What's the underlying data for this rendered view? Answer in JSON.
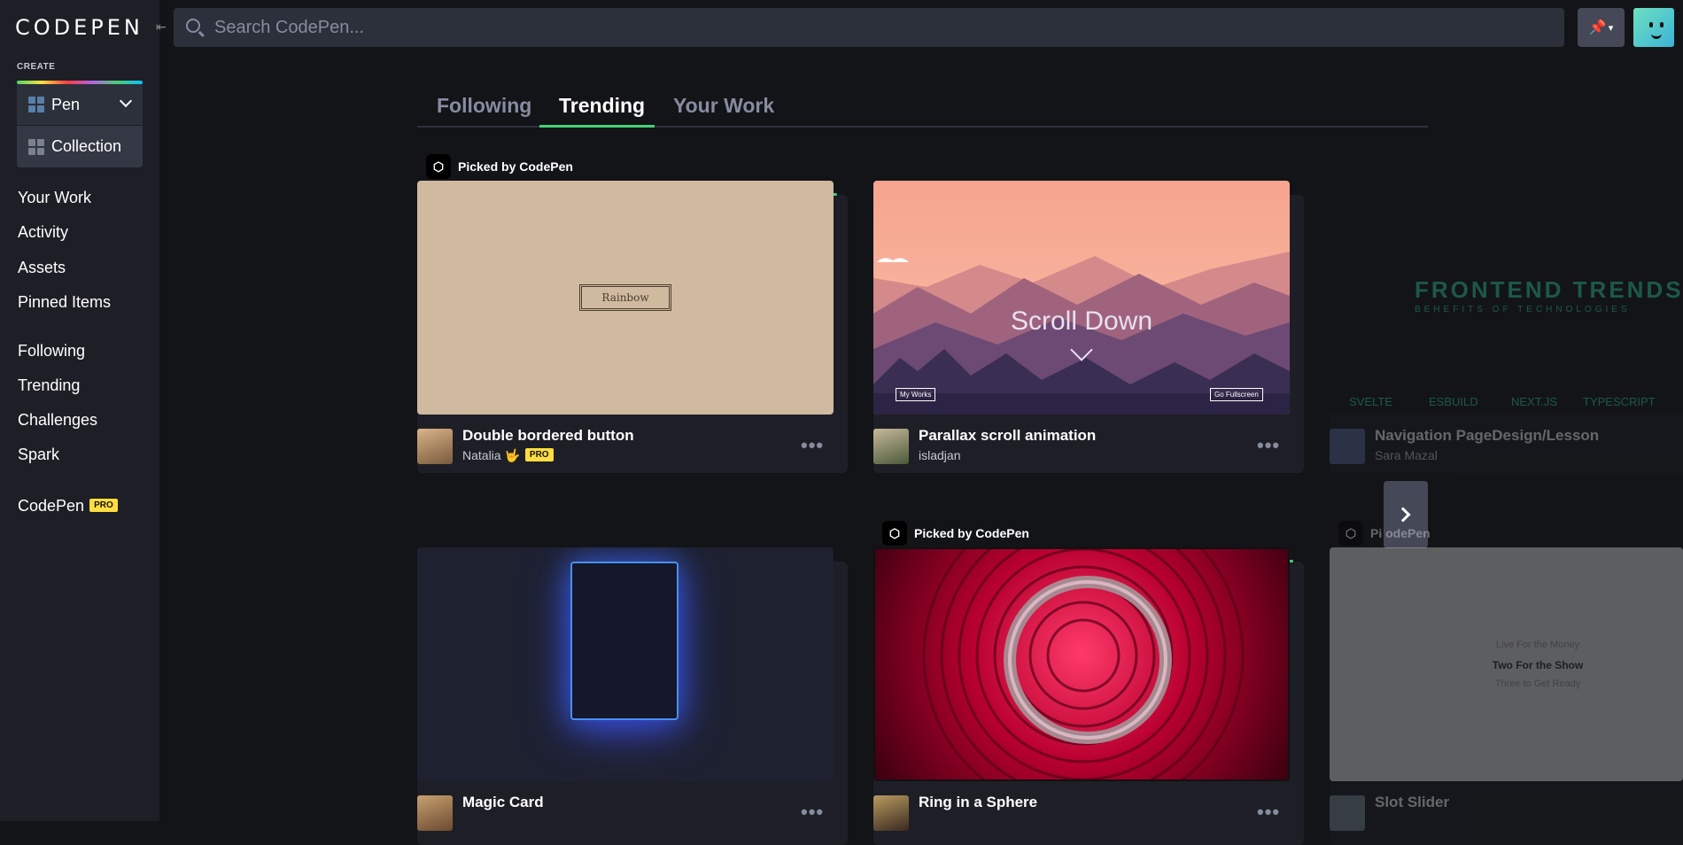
{
  "brand": {
    "logo": "CODEPEN"
  },
  "sidebar": {
    "create_label": "CREATE",
    "create_items": [
      {
        "label": "Pen"
      },
      {
        "label": "Collection"
      }
    ],
    "nav_group1": [
      "Your Work",
      "Activity",
      "Assets",
      "Pinned Items"
    ],
    "nav_group2": [
      "Following",
      "Trending",
      "Challenges",
      "Spark"
    ],
    "codepen_pro_label": "CodePen",
    "pro_badge": "PRO"
  },
  "search": {
    "placeholder": "Search CodePen..."
  },
  "tabs": [
    "Following",
    "Trending",
    "Your Work"
  ],
  "active_tab": "Trending",
  "picked_label": "Picked by CodePen",
  "cards": [
    {
      "title": "Double bordered button",
      "author": "Natalia 🤟",
      "pro": "PRO",
      "picked": true,
      "thumb_text": "Rainbow"
    },
    {
      "title": "Parallax scroll animation",
      "author": "isladjan",
      "picked": false,
      "thumb_text": "Scroll Down",
      "btn_left": "My Works",
      "btn_right": "Go Fullscreen"
    },
    {
      "title": "Navigation PageDesign/Lesson",
      "author": "Sara Mazal",
      "picked": false,
      "thumb_title": "FRONTEND TRENDS",
      "thumb_subtitle": "BEHEFITS OF TECHNOLOGIES",
      "thumb_tags": [
        "SVELTE",
        "ESBUILD",
        "NEXT.JS",
        "TYPESCRIPT"
      ]
    },
    {
      "title": "Magic Card",
      "author": "",
      "picked": false
    },
    {
      "title": "Ring in a Sphere",
      "author": "",
      "picked": true
    },
    {
      "title": "Slot Slider",
      "author": "",
      "picked": true,
      "picked_partial": "Pi        odePen",
      "thumb_lines": [
        "Live For the Money",
        "Two For the Show",
        "Three to Get Ready"
      ]
    }
  ],
  "colors": {
    "accent": "#47cf73",
    "pro": "#ffdd40",
    "bg": "#131417",
    "sidebar": "#1e1f26"
  }
}
